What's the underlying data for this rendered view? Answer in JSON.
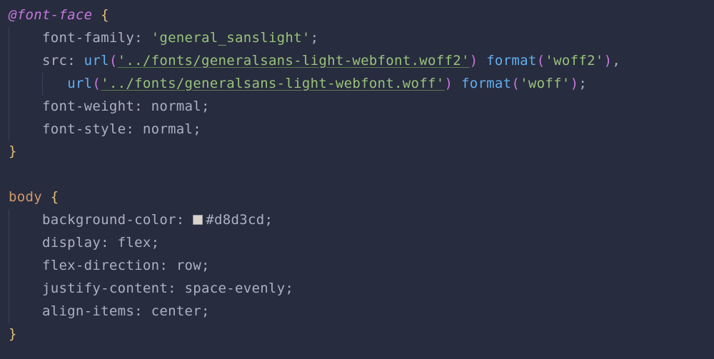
{
  "code": {
    "line1": {
      "at_rule": "@font-face",
      "brace_open": " {"
    },
    "line2": {
      "property": "font-family",
      "value": "'general_sanslight'"
    },
    "line3": {
      "property": "src",
      "func1": "url",
      "url1": "'../fonts/generalsans-light-webfont.woff2'",
      "func2": "format",
      "fmt1": "'woff2'"
    },
    "line4": {
      "func1": "url",
      "url1": "'../fonts/generalsans-light-webfont.woff'",
      "func2": "format",
      "fmt1": "'woff'"
    },
    "line5": {
      "property": "font-weight",
      "value": "normal"
    },
    "line6": {
      "property": "font-style",
      "value": "normal"
    },
    "line7": {
      "brace_close": "}"
    },
    "line9": {
      "selector": "body",
      "brace_open": " {"
    },
    "line10": {
      "property": "background-color",
      "swatch_color": "#d8d3cd",
      "value": "#d8d3cd"
    },
    "line11": {
      "property": "display",
      "value": "flex"
    },
    "line12": {
      "property": "flex-direction",
      "value": "row"
    },
    "line13": {
      "property": "justify-content",
      "value": "space-evenly"
    },
    "line14": {
      "property": "align-items",
      "value": "center"
    },
    "line15": {
      "brace_close": "}"
    }
  }
}
